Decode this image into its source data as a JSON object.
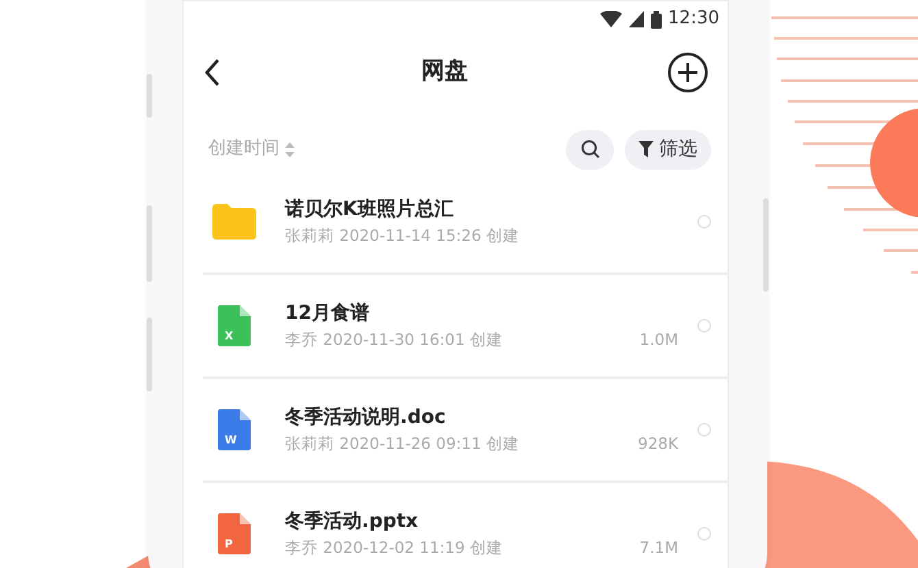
{
  "status_bar": {
    "time": "12:30"
  },
  "header": {
    "title": "网盘"
  },
  "toolbar": {
    "sort_label": "创建时间",
    "filter_label": "筛选"
  },
  "files": [
    {
      "kind": "folder",
      "name": "诺贝尔K班照片总汇",
      "meta": "张莉莉 2020-11-14 15:26 创建",
      "selected": false
    },
    {
      "kind": "sheet",
      "icon_letter": "X",
      "name": "12月食谱",
      "meta": "李乔 2020-11-30 16:01 创建",
      "size": "1.0M",
      "selected": false
    },
    {
      "kind": "doc",
      "icon_letter": "W",
      "name": "冬季活动说明.doc",
      "meta": "张莉莉 2020-11-26 09:11 创建",
      "size": "928K",
      "selected": false
    },
    {
      "kind": "slides",
      "icon_letter": "P",
      "name": "冬季活动.pptx",
      "meta": "李乔 2020-12-02 11:19 创建",
      "size": "7.1M",
      "selected": false
    }
  ]
}
